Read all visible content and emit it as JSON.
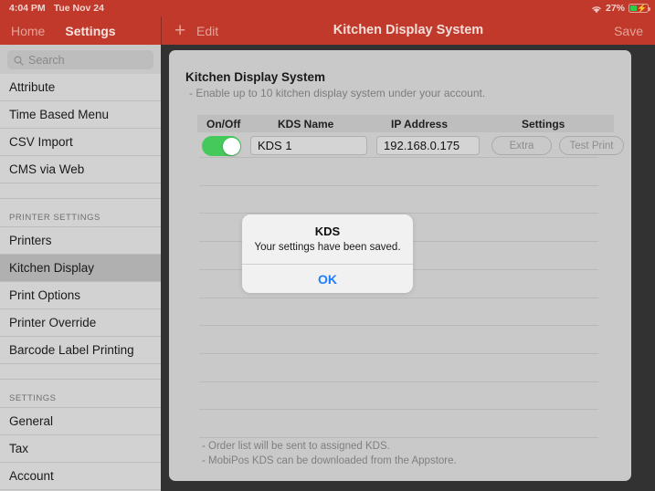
{
  "statusbar": {
    "time": "4:04 PM",
    "date": "Tue Nov 24",
    "wifi_icon": "wifi-icon",
    "battery_percent": "27%",
    "battery_icon": "battery-charging-icon"
  },
  "nav": {
    "home_label": "Home",
    "settings_label": "Settings",
    "add_icon": "plus-icon",
    "edit_label": "Edit",
    "title": "Kitchen Display System",
    "save_label": "Save"
  },
  "search": {
    "placeholder": "Search",
    "value": "",
    "icon": "search-icon"
  },
  "sidebar": {
    "items": [
      {
        "label": "Attribute",
        "type": "item",
        "selected": false
      },
      {
        "label": "Time Based Menu",
        "type": "item",
        "selected": false
      },
      {
        "label": "CSV Import",
        "type": "item",
        "selected": false
      },
      {
        "label": "CMS via Web",
        "type": "item",
        "selected": false
      },
      {
        "label": "",
        "type": "gap",
        "selected": false
      },
      {
        "label": "PRINTER SETTINGS",
        "type": "group",
        "selected": false
      },
      {
        "label": "Printers",
        "type": "item",
        "selected": false
      },
      {
        "label": "Kitchen Display",
        "type": "item",
        "selected": true
      },
      {
        "label": "Print Options",
        "type": "item",
        "selected": false
      },
      {
        "label": "Printer Override",
        "type": "item",
        "selected": false
      },
      {
        "label": "Barcode Label Printing",
        "type": "item",
        "selected": false
      },
      {
        "label": "",
        "type": "gap",
        "selected": false
      },
      {
        "label": "SETTINGS",
        "type": "group",
        "selected": false
      },
      {
        "label": "General",
        "type": "item",
        "selected": false
      },
      {
        "label": "Tax",
        "type": "item",
        "selected": false
      },
      {
        "label": "Account",
        "type": "item",
        "selected": false
      }
    ]
  },
  "panel": {
    "title": "Kitchen Display System",
    "subtitle": "- Enable up to 10 kitchen display system under your account.",
    "columns": {
      "onoff": "On/Off",
      "name": "KDS Name",
      "ip": "IP Address",
      "settings": "Settings"
    },
    "rows": [
      {
        "enabled": true,
        "name": "KDS 1",
        "ip": "192.168.0.175",
        "extra_label": "Extra",
        "test_print_label": "Test Print"
      }
    ],
    "separator_rows": 11,
    "footer_line1": "- Order list will be sent to assigned KDS.",
    "footer_line2": "- MobiPos KDS can be downloaded from the Appstore."
  },
  "alert": {
    "title": "KDS",
    "message": "Your settings have been saved.",
    "ok_label": "OK"
  },
  "colors": {
    "navbar": "#c1392b",
    "toggle_on": "#45c95a",
    "alert_action": "#1d7efd",
    "sidebar": "#d2d2d2",
    "panel": "#c9c9c9"
  }
}
